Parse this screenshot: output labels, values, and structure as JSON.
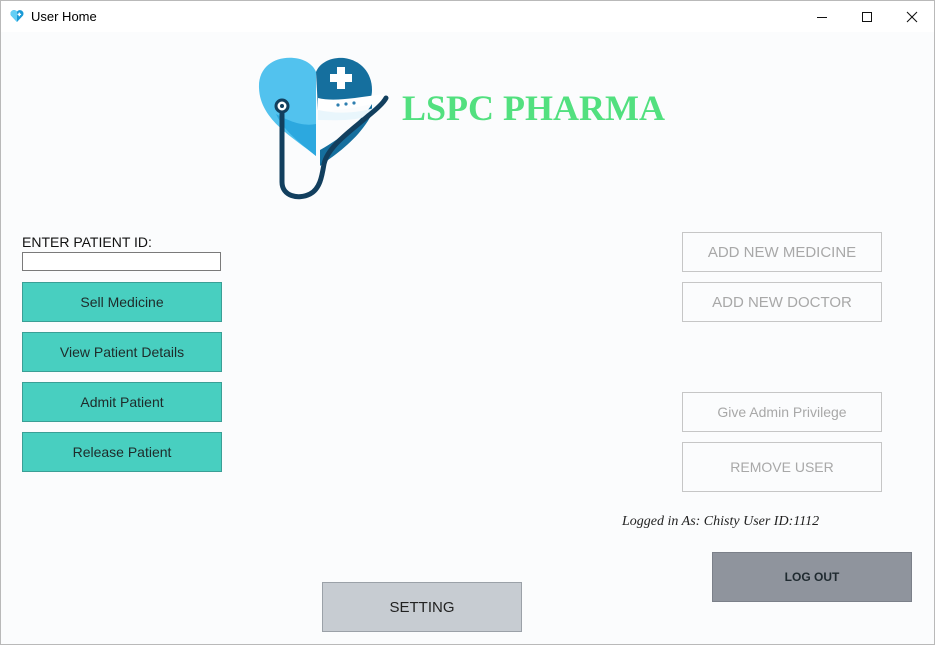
{
  "window": {
    "title": "User Home",
    "app_icon": "heart-stethoscope-icon",
    "controls": [
      "minimize-icon",
      "maximize-icon",
      "close-icon"
    ]
  },
  "brand": {
    "name": "LSPC PHARMA",
    "logo_icon": "heart-stethoscope-logo",
    "color": "#52e07f"
  },
  "patient": {
    "id_label": "ENTER PATIENT ID:",
    "id_value": "",
    "actions": [
      "Sell Medicine",
      "View Patient Details",
      "Admit Patient",
      "Release Patient"
    ]
  },
  "admin": {
    "add_medicine": "ADD NEW MEDICINE",
    "add_doctor": "ADD NEW DOCTOR",
    "give_admin": "Give Admin Privilege",
    "remove_user": "REMOVE USER"
  },
  "status": {
    "logged_in": "Logged in As: Chisty User ID:1112"
  },
  "footer": {
    "logout": "LOG OUT",
    "setting": "SETTING"
  },
  "colors": {
    "action_button": "#48cfc0",
    "logout_button": "#8f949d",
    "setting_button": "#c7ccd2",
    "disabled_text": "#a8a8a8"
  }
}
